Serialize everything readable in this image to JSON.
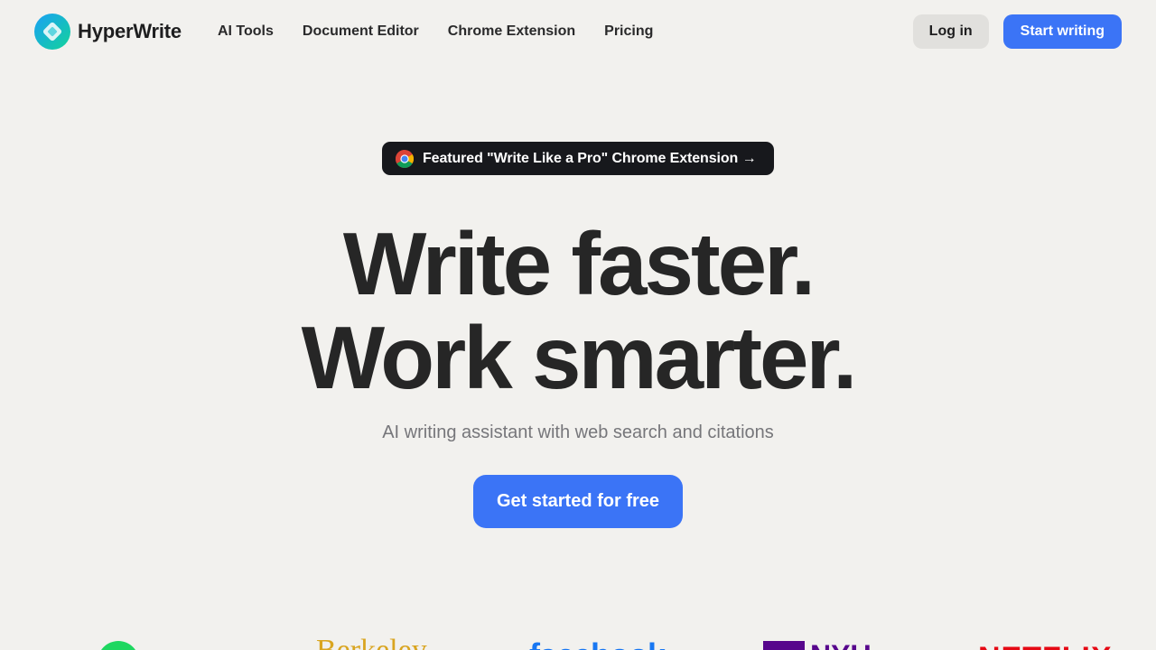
{
  "brand": {
    "name": "HyperWrite"
  },
  "nav": {
    "items": [
      "AI Tools",
      "Document Editor",
      "Chrome Extension",
      "Pricing"
    ]
  },
  "header": {
    "login_label": "Log in",
    "start_label": "Start writing"
  },
  "hero": {
    "badge": "Featured \"Write Like a Pro\" Chrome Extension →",
    "headline_line1": "Write faster.",
    "headline_line2": "Work smarter.",
    "subtitle": "AI writing assistant with web search and citations",
    "cta": "Get started for free"
  },
  "logos": {
    "items": [
      "Berkeley",
      "facebook",
      "NYU",
      "NETFLIX"
    ],
    "icons": [
      "spotify-logo",
      "berkeley-logo",
      "facebook-logo",
      "nyu-logo",
      "netflix-logo"
    ]
  },
  "colors": {
    "background": "#f2f1ee",
    "accent": "#3b74f6",
    "badge_bg": "#17181c",
    "headline": "#262626",
    "subtitle": "#76767a"
  }
}
